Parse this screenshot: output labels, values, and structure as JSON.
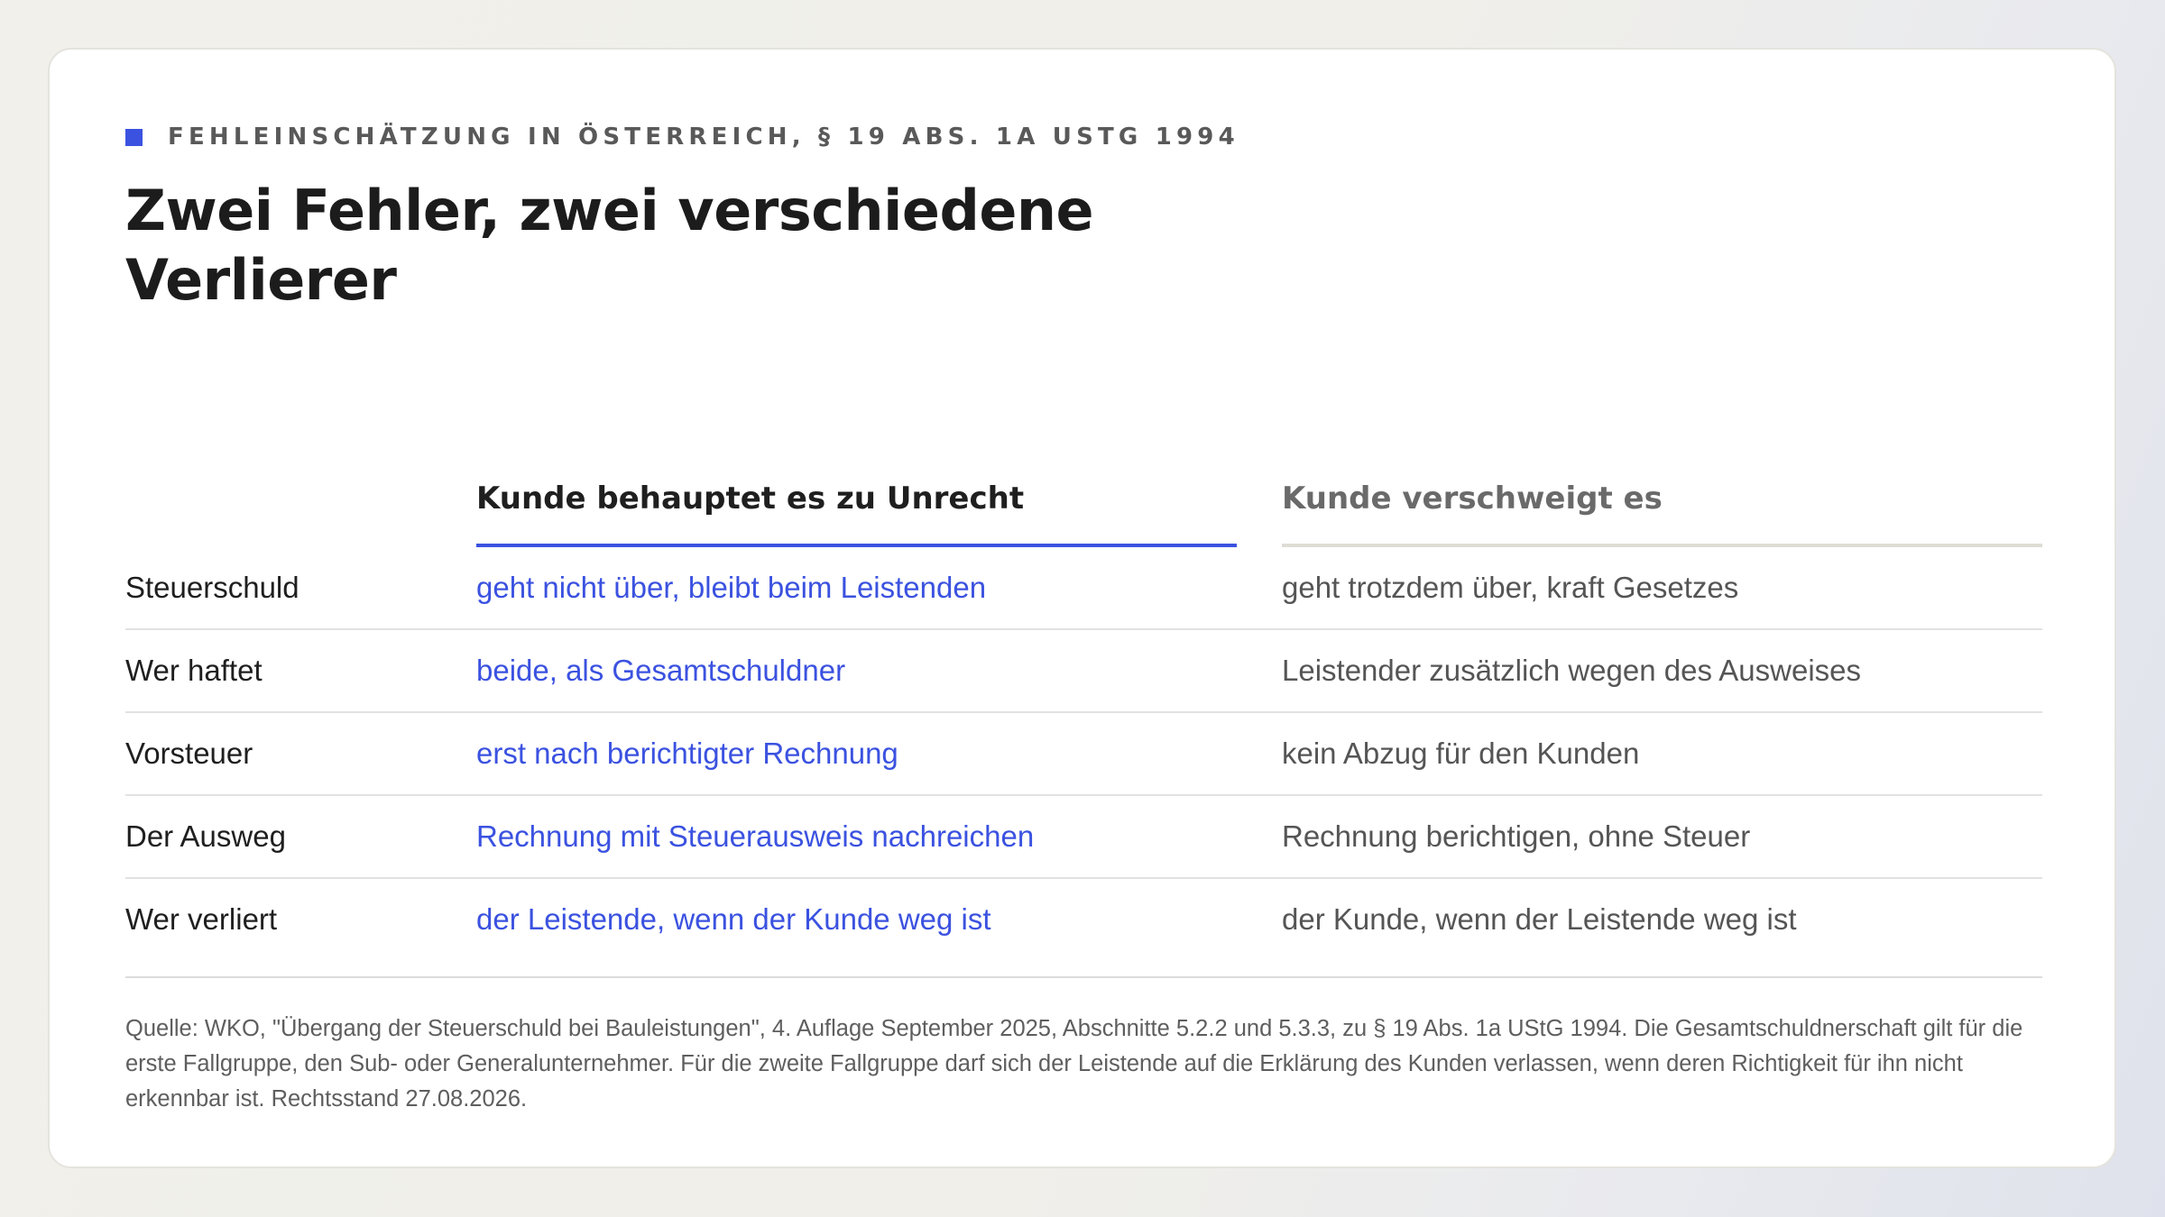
{
  "eyebrow": "FEHLEINSCHÄTZUNG IN ÖSTERREICH, § 19 ABS. 1A USTG 1994",
  "title": "Zwei Fehler, zwei verschiedene Verlierer",
  "colors": {
    "accent": "#3b52e0",
    "text": "#1f1f1f",
    "muted": "#555555"
  },
  "table": {
    "columns": [
      "Kunde behauptet es zu Unrecht",
      "Kunde verschweigt es"
    ],
    "rows": [
      {
        "label": "Steuerschuld",
        "a": "geht nicht über, bleibt beim Leistenden",
        "b": "geht trotzdem über, kraft Gesetzes"
      },
      {
        "label": "Wer haftet",
        "a": "beide, als Gesamtschuldner",
        "b": "Leistender zusätzlich wegen des Ausweises"
      },
      {
        "label": "Vorsteuer",
        "a": "erst nach berichtigter Rechnung",
        "b": "kein Abzug für den Kunden"
      },
      {
        "label": "Der Ausweg",
        "a": "Rechnung mit Steuerausweis nachreichen",
        "b": "Rechnung berichtigen, ohne Steuer"
      },
      {
        "label": "Wer verliert",
        "a": "der Leistende, wenn der Kunde weg ist",
        "b": "der Kunde, wenn der Leistende weg ist"
      }
    ]
  },
  "source": "Quelle: WKO, \"Übergang der Steuerschuld bei Bauleistungen\", 4. Auflage September 2025, Abschnitte 5.2.2 und 5.3.3, zu § 19 Abs. 1a UStG 1994. Die Gesamtschuldnerschaft gilt für die erste Fallgruppe, den Sub- oder Generalunternehmer. Für die zweite Fallgruppe darf sich der Leistende auf die Erklärung des Kunden verlassen, wenn deren Richtigkeit für ihn nicht erkennbar ist. Rechtsstand 27.08.2026."
}
